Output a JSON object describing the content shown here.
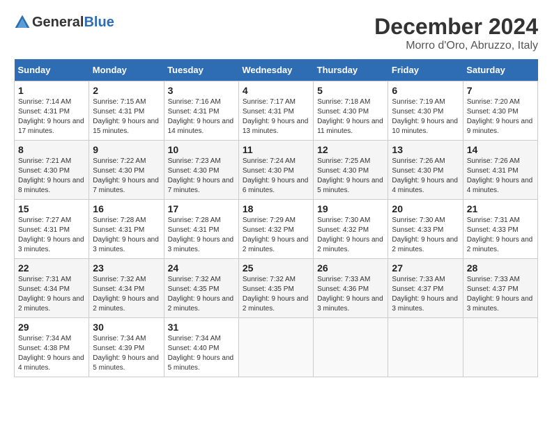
{
  "header": {
    "logo_general": "General",
    "logo_blue": "Blue",
    "month_title": "December 2024",
    "location": "Morro d'Oro, Abruzzo, Italy"
  },
  "days_of_week": [
    "Sunday",
    "Monday",
    "Tuesday",
    "Wednesday",
    "Thursday",
    "Friday",
    "Saturday"
  ],
  "weeks": [
    [
      {
        "day": "1",
        "sunrise": "7:14 AM",
        "sunset": "4:31 PM",
        "daylight": "9 hours and 17 minutes."
      },
      {
        "day": "2",
        "sunrise": "7:15 AM",
        "sunset": "4:31 PM",
        "daylight": "9 hours and 15 minutes."
      },
      {
        "day": "3",
        "sunrise": "7:16 AM",
        "sunset": "4:31 PM",
        "daylight": "9 hours and 14 minutes."
      },
      {
        "day": "4",
        "sunrise": "7:17 AM",
        "sunset": "4:31 PM",
        "daylight": "9 hours and 13 minutes."
      },
      {
        "day": "5",
        "sunrise": "7:18 AM",
        "sunset": "4:30 PM",
        "daylight": "9 hours and 11 minutes."
      },
      {
        "day": "6",
        "sunrise": "7:19 AM",
        "sunset": "4:30 PM",
        "daylight": "9 hours and 10 minutes."
      },
      {
        "day": "7",
        "sunrise": "7:20 AM",
        "sunset": "4:30 PM",
        "daylight": "9 hours and 9 minutes."
      }
    ],
    [
      {
        "day": "8",
        "sunrise": "7:21 AM",
        "sunset": "4:30 PM",
        "daylight": "9 hours and 8 minutes."
      },
      {
        "day": "9",
        "sunrise": "7:22 AM",
        "sunset": "4:30 PM",
        "daylight": "9 hours and 7 minutes."
      },
      {
        "day": "10",
        "sunrise": "7:23 AM",
        "sunset": "4:30 PM",
        "daylight": "9 hours and 7 minutes."
      },
      {
        "day": "11",
        "sunrise": "7:24 AM",
        "sunset": "4:30 PM",
        "daylight": "9 hours and 6 minutes."
      },
      {
        "day": "12",
        "sunrise": "7:25 AM",
        "sunset": "4:30 PM",
        "daylight": "9 hours and 5 minutes."
      },
      {
        "day": "13",
        "sunrise": "7:26 AM",
        "sunset": "4:30 PM",
        "daylight": "9 hours and 4 minutes."
      },
      {
        "day": "14",
        "sunrise": "7:26 AM",
        "sunset": "4:31 PM",
        "daylight": "9 hours and 4 minutes."
      }
    ],
    [
      {
        "day": "15",
        "sunrise": "7:27 AM",
        "sunset": "4:31 PM",
        "daylight": "9 hours and 3 minutes."
      },
      {
        "day": "16",
        "sunrise": "7:28 AM",
        "sunset": "4:31 PM",
        "daylight": "9 hours and 3 minutes."
      },
      {
        "day": "17",
        "sunrise": "7:28 AM",
        "sunset": "4:31 PM",
        "daylight": "9 hours and 3 minutes."
      },
      {
        "day": "18",
        "sunrise": "7:29 AM",
        "sunset": "4:32 PM",
        "daylight": "9 hours and 2 minutes."
      },
      {
        "day": "19",
        "sunrise": "7:30 AM",
        "sunset": "4:32 PM",
        "daylight": "9 hours and 2 minutes."
      },
      {
        "day": "20",
        "sunrise": "7:30 AM",
        "sunset": "4:33 PM",
        "daylight": "9 hours and 2 minutes."
      },
      {
        "day": "21",
        "sunrise": "7:31 AM",
        "sunset": "4:33 PM",
        "daylight": "9 hours and 2 minutes."
      }
    ],
    [
      {
        "day": "22",
        "sunrise": "7:31 AM",
        "sunset": "4:34 PM",
        "daylight": "9 hours and 2 minutes."
      },
      {
        "day": "23",
        "sunrise": "7:32 AM",
        "sunset": "4:34 PM",
        "daylight": "9 hours and 2 minutes."
      },
      {
        "day": "24",
        "sunrise": "7:32 AM",
        "sunset": "4:35 PM",
        "daylight": "9 hours and 2 minutes."
      },
      {
        "day": "25",
        "sunrise": "7:32 AM",
        "sunset": "4:35 PM",
        "daylight": "9 hours and 2 minutes."
      },
      {
        "day": "26",
        "sunrise": "7:33 AM",
        "sunset": "4:36 PM",
        "daylight": "9 hours and 3 minutes."
      },
      {
        "day": "27",
        "sunrise": "7:33 AM",
        "sunset": "4:37 PM",
        "daylight": "9 hours and 3 minutes."
      },
      {
        "day": "28",
        "sunrise": "7:33 AM",
        "sunset": "4:37 PM",
        "daylight": "9 hours and 3 minutes."
      }
    ],
    [
      {
        "day": "29",
        "sunrise": "7:34 AM",
        "sunset": "4:38 PM",
        "daylight": "9 hours and 4 minutes."
      },
      {
        "day": "30",
        "sunrise": "7:34 AM",
        "sunset": "4:39 PM",
        "daylight": "9 hours and 5 minutes."
      },
      {
        "day": "31",
        "sunrise": "7:34 AM",
        "sunset": "4:40 PM",
        "daylight": "9 hours and 5 minutes."
      },
      null,
      null,
      null,
      null
    ]
  ]
}
